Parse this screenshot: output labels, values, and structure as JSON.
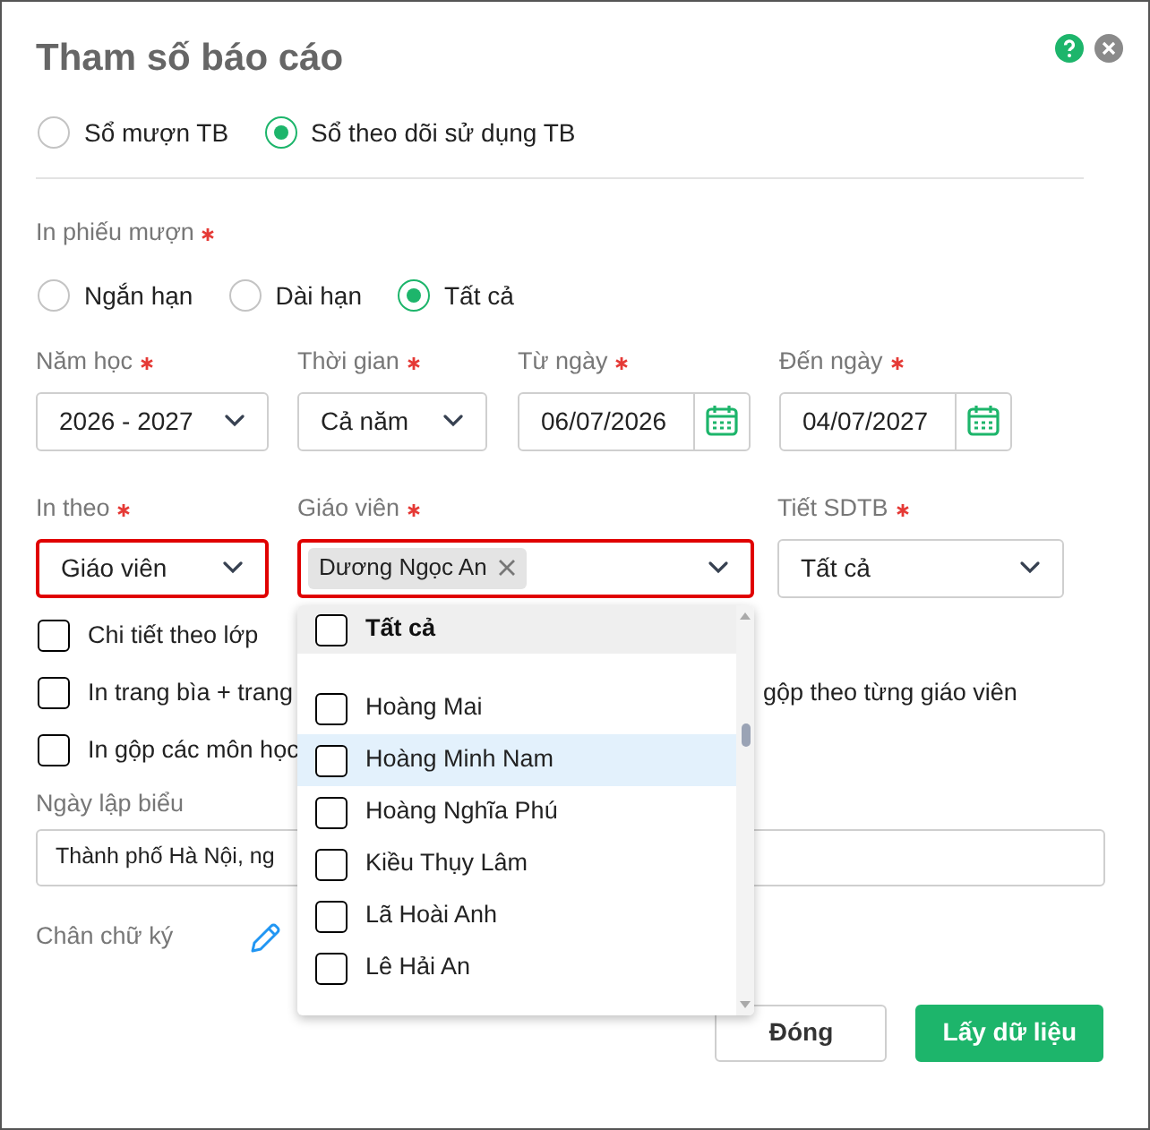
{
  "dialog": {
    "title": "Tham số báo cáo"
  },
  "report_type": [
    {
      "label": "Sổ mượn TB",
      "selected": false
    },
    {
      "label": "Sổ theo dõi sử dụng TB",
      "selected": true
    }
  ],
  "loan_slip": {
    "label": "In phiếu mượn",
    "required": true,
    "options": [
      {
        "label": "Ngắn hạn",
        "selected": false
      },
      {
        "label": "Dài hạn",
        "selected": false
      },
      {
        "label": "Tất cả",
        "selected": true
      }
    ]
  },
  "fields_row1": [
    {
      "kind": "select",
      "label": "Năm học",
      "required": true,
      "value": "2026 - 2027"
    },
    {
      "kind": "select",
      "label": "Thời gian",
      "required": true,
      "value": "Cả năm"
    },
    {
      "kind": "date",
      "label": "Từ ngày",
      "required": true,
      "value": "06/07/2026"
    },
    {
      "kind": "date",
      "label": "Đến ngày",
      "required": true,
      "value": "04/07/2027"
    }
  ],
  "fields_row2": [
    {
      "kind": "select",
      "label": "In theo",
      "required": true,
      "invalid": true,
      "value": "Giáo viên"
    },
    {
      "kind": "multiselect",
      "label": "Giáo viên",
      "required": true,
      "invalid": true,
      "tags": [
        "Dương Ngọc An"
      ]
    },
    {
      "kind": "select",
      "label": "Tiết SDTB",
      "required": true,
      "invalid": false,
      "value": "Tất cả"
    }
  ],
  "checkboxes": [
    {
      "label": "Chi tiết theo lớp",
      "checked": false
    },
    {
      "label": "In trang bìa + trang",
      "label_continued": "gộp theo từng giáo viên",
      "checked": false
    },
    {
      "label": "In gộp các môn học",
      "checked": false
    }
  ],
  "date_field": {
    "label": "Ngày lập biểu",
    "value": "Thành phố Hà Nội, ng"
  },
  "signature": {
    "label": "Chân chữ ký"
  },
  "dropdown": {
    "all_option": {
      "label": "Tất cả",
      "checked": false
    },
    "items": [
      {
        "label": "Hoàng Mai",
        "checked": false,
        "highlighted": false
      },
      {
        "label": "Hoàng Minh Nam",
        "checked": false,
        "highlighted": true
      },
      {
        "label": "Hoàng Nghĩa Phú",
        "checked": false,
        "highlighted": false
      },
      {
        "label": "Kiều Thụy Lâm",
        "checked": false,
        "highlighted": false
      },
      {
        "label": "Lã Hoài Anh",
        "checked": false,
        "highlighted": false
      },
      {
        "label": "Lê Hải An",
        "checked": false,
        "highlighted": false
      }
    ]
  },
  "buttons": [
    {
      "label": "Đóng",
      "kind": "secondary"
    },
    {
      "label": "Lấy dữ liệu",
      "kind": "primary"
    }
  ]
}
